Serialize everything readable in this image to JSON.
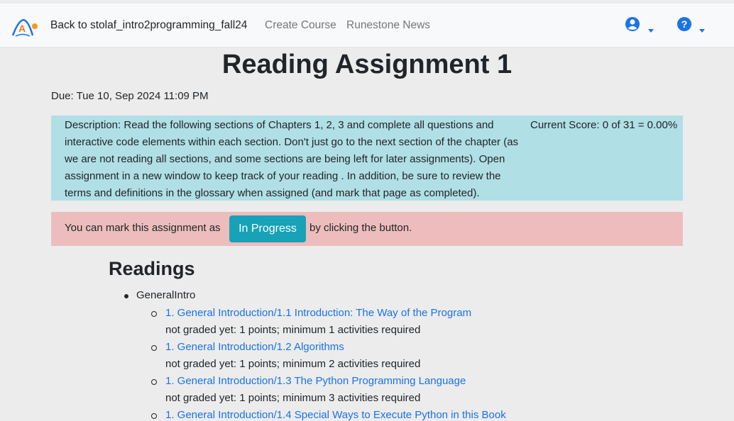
{
  "nav": {
    "back_label": "Back to stolaf_intro2programming_fall24",
    "links": [
      "Create Course",
      "Runestone News"
    ],
    "colors": {
      "accent": "#1a73e8",
      "logo_orange": "#f39c12"
    }
  },
  "assignment": {
    "title": "Reading Assignment 1",
    "due": "Due: Tue 10, Sep 2024 11:09 PM",
    "description": "Description: Read the following sections of Chapters 1, 2, 3 and complete all questions and interactive code elements within each section. Don't just go to the next section of the chapter (as we are not reading all sections, and some sections are being left for later assignments). Open assignment in a new window to keep track of your reading . In addition, be sure to review the terms and definitions in the glossary when assigned (and mark that page as completed).",
    "score": "Current Score: 0 of 31 = 0.00%"
  },
  "status": {
    "pre": "You can mark this assignment as",
    "button": "In Progress",
    "post": "by clicking the button.",
    "button_color": "#17a2b8"
  },
  "readings": {
    "heading": "Readings",
    "chapter": "GeneralIntro",
    "items": [
      {
        "title": "1. General Introduction/1.1 Introduction: The Way of the Program",
        "meta": "not graded yet: 1 points; minimum 1 activities required"
      },
      {
        "title": "1. General Introduction/1.2 Algorithms",
        "meta": "not graded yet: 1 points; minimum 2 activities required"
      },
      {
        "title": "1. General Introduction/1.3 The Python Programming Language",
        "meta": "not graded yet: 1 points; minimum 3 activities required"
      },
      {
        "title": "1. General Introduction/1.4 Special Ways to Execute Python in this Book",
        "meta": ""
      }
    ]
  }
}
